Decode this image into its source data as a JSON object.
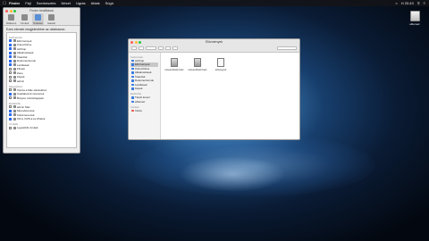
{
  "menubar": {
    "app": "Finder",
    "items": [
      "Fájl",
      "Szerkesztés",
      "Nézet",
      "Ugrás",
      "Ablak",
      "Súgó"
    ],
    "clock": "H 20:43"
  },
  "desktop": {
    "drive_label": "eRemeir"
  },
  "prefs": {
    "title": "Finder beállításai",
    "tabs": [
      "Általános",
      "Címkék",
      "Oldalsáv",
      "Haladó"
    ],
    "heading": "Ezen elemek megjelenítése az oldalsávon:",
    "sections": [
      {
        "title": "Kedvencek",
        "items": [
          {
            "label": "Előzmények",
            "checked": true
          },
          {
            "label": "iCloud Drive",
            "checked": true
          },
          {
            "label": "AirDrop",
            "checked": true
          },
          {
            "label": "Alkalmazások",
            "checked": true
          },
          {
            "label": "Íróasztal",
            "checked": true
          },
          {
            "label": "Dokumentumok",
            "checked": true
          },
          {
            "label": "Letöltések",
            "checked": true
          },
          {
            "label": "Filmek",
            "checked": false
          },
          {
            "label": "Zene",
            "checked": false
          },
          {
            "label": "Képek",
            "checked": false
          },
          {
            "label": "admin",
            "checked": false
          }
        ]
      },
      {
        "title": "Megosztott",
        "items": [
          {
            "label": "Vissza a Mac eléréséhez",
            "checked": false
          },
          {
            "label": "Csatlakozott szerverek",
            "checked": true
          },
          {
            "label": "Bonjour számítógépek",
            "checked": false
          }
        ]
      },
      {
        "title": "Eszközök",
        "items": [
          {
            "label": "admin Mac",
            "checked": false
          },
          {
            "label": "Merevlemezek",
            "checked": true
          },
          {
            "label": "Külső lemezek",
            "checked": true
          },
          {
            "label": "CD-k, DVD-k és iPodok",
            "checked": true
          }
        ]
      },
      {
        "title": "Címkék",
        "items": [
          {
            "label": "Legutóbbi címkék",
            "checked": false
          }
        ]
      }
    ]
  },
  "finder": {
    "title": "Előzmények",
    "sidebar": [
      {
        "title": "Kedvencek",
        "items": [
          {
            "label": "AirDrop",
            "selected": false,
            "red": false
          },
          {
            "label": "Előzmények",
            "selected": true,
            "red": false
          },
          {
            "label": "iCloud Drive",
            "selected": false,
            "red": false
          },
          {
            "label": "Alkalmazások",
            "selected": false,
            "red": false
          },
          {
            "label": "Íróasztal",
            "selected": false,
            "red": false
          },
          {
            "label": "Dokumentumok",
            "selected": false,
            "red": false
          },
          {
            "label": "Letöltések",
            "selected": false,
            "red": false
          },
          {
            "label": "Képek",
            "selected": false,
            "red": false
          }
        ]
      },
      {
        "title": "Eszközök",
        "items": [
          {
            "label": "Távoli lemez",
            "selected": false,
            "red": false
          },
          {
            "label": "eRemeir",
            "selected": false,
            "red": false
          }
        ]
      },
      {
        "title": "Címkék",
        "items": [
          {
            "label": "Vörös",
            "selected": false,
            "red": true
          }
        ]
      }
    ],
    "files": [
      {
        "label": "screenshot1.heic",
        "type": "image"
      },
      {
        "label": "screenshot1.heic",
        "type": "image"
      },
      {
        "label": "szöveg.txt",
        "type": "text"
      }
    ]
  }
}
